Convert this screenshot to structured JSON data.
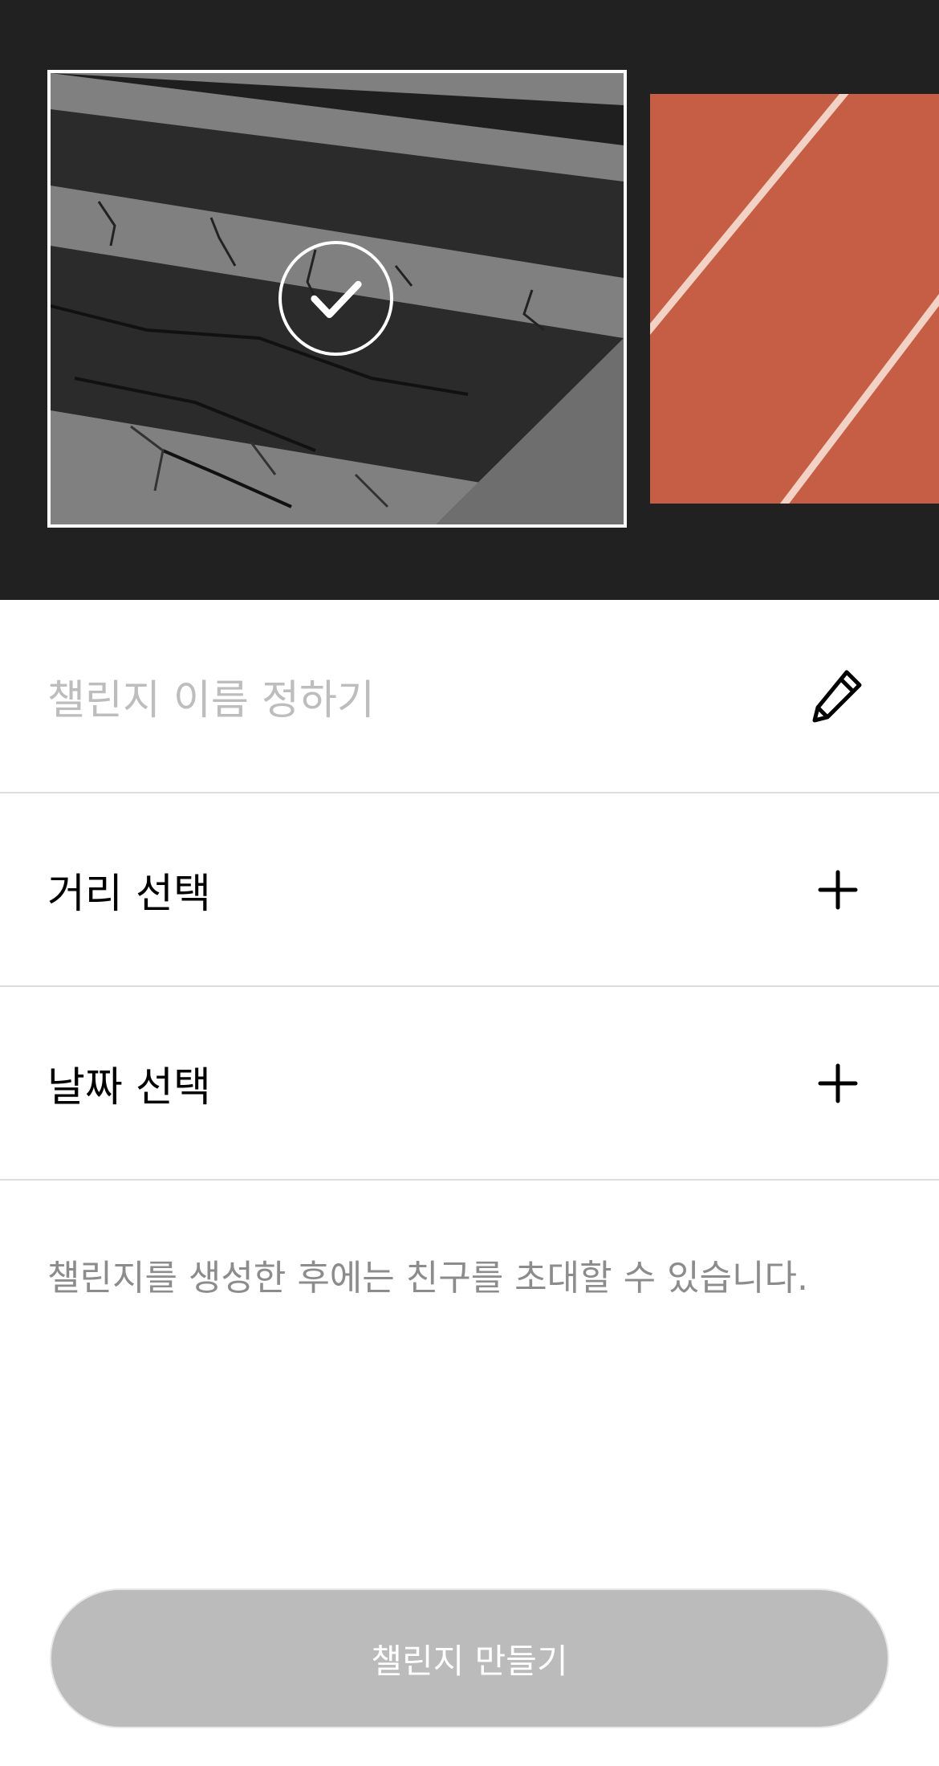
{
  "carousel": {
    "images": [
      {
        "name": "crosswalk-asphalt",
        "selected": true
      },
      {
        "name": "running-track",
        "selected": false
      }
    ],
    "selected_icon": "checkmark-icon"
  },
  "form": {
    "name_placeholder": "챌린지 이름 정하기",
    "name_icon": "pencil-icon",
    "distance_label": "거리 선택",
    "distance_icon": "plus-icon",
    "date_label": "날짜 선택",
    "date_icon": "plus-icon"
  },
  "info": "챌린지를 생성한 후에는 친구를 초대할 수 있습니다.",
  "create_button": {
    "label": "챌린지 만들기",
    "enabled": false
  },
  "colors": {
    "header_bg": "#212121",
    "placeholder": "#bdbdbd",
    "info_text": "#8c8c8c",
    "button_disabled": "#bbbbbb",
    "track": "#c65d45"
  }
}
